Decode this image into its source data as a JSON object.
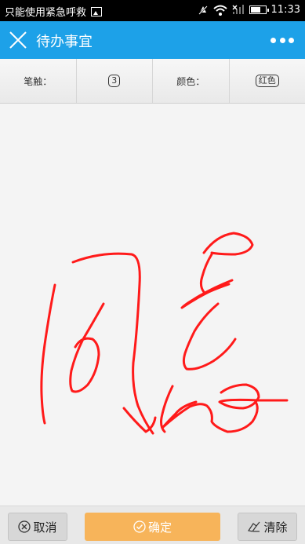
{
  "status_bar": {
    "carrier_text": "只能使用紧急呼救",
    "time": "11:33",
    "icons": [
      "image-icon",
      "mute-icon",
      "wifi-icon",
      "signal-icon",
      "battery-icon"
    ]
  },
  "header": {
    "title": "待办事宜",
    "close_icon": "close-icon",
    "more_icon": "more-icon",
    "background": "#1da1e8"
  },
  "toolbar": {
    "pen_label": "笔触：",
    "pen_value": "3",
    "color_label": "颜色：",
    "color_value": "红色"
  },
  "canvas": {
    "ink_color": "#ff1a1a"
  },
  "bottom": {
    "cancel_label": "取消",
    "ok_label": "确定",
    "clear_label": "清除",
    "ok_color": "#f7b45a"
  }
}
